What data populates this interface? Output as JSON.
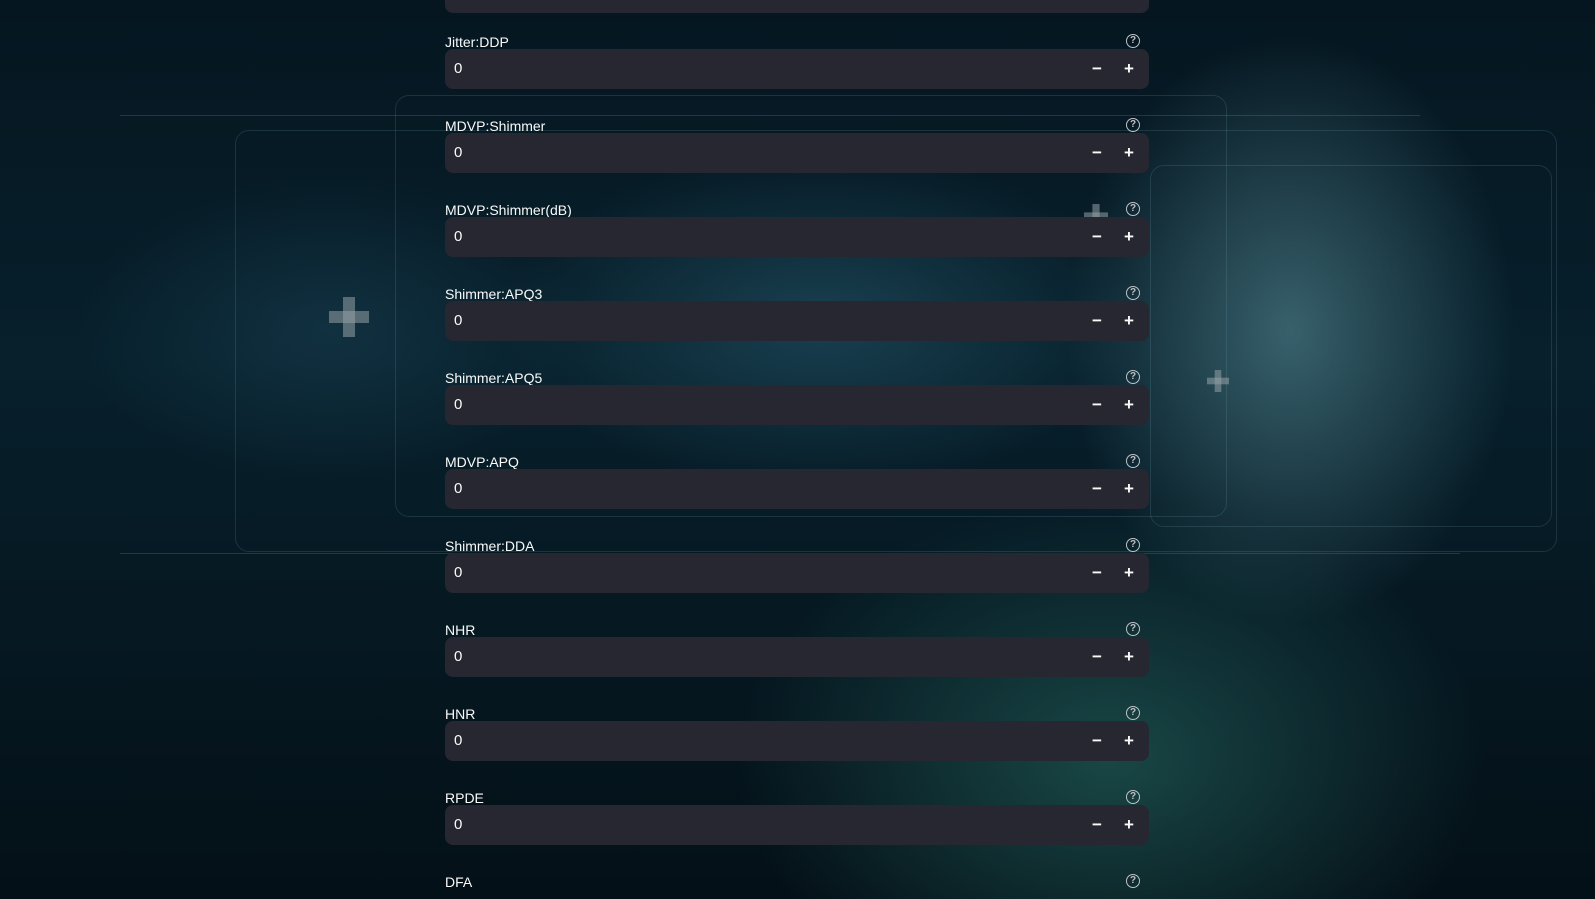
{
  "form": {
    "fields": [
      {
        "label": "Jitter:DDP",
        "value": "0"
      },
      {
        "label": "MDVP:Shimmer",
        "value": "0"
      },
      {
        "label": "MDVP:Shimmer(dB)",
        "value": "0"
      },
      {
        "label": "Shimmer:APQ3",
        "value": "0"
      },
      {
        "label": "Shimmer:APQ5",
        "value": "0"
      },
      {
        "label": "MDVP:APQ",
        "value": "0"
      },
      {
        "label": "Shimmer:DDA",
        "value": "0"
      },
      {
        "label": "NHR",
        "value": "0"
      },
      {
        "label": "HNR",
        "value": "0"
      },
      {
        "label": "RPDE",
        "value": "0"
      },
      {
        "label": "DFA",
        "value": ""
      }
    ],
    "help_glyph": "?",
    "decrement_glyph": "−",
    "increment_glyph": "+"
  },
  "icons": {
    "help": "help-circle-icon",
    "decrement": "minus-icon",
    "increment": "plus-icon"
  },
  "colors": {
    "input_background": "#262730",
    "text": "#fafafa",
    "page_background": "#04121c"
  }
}
